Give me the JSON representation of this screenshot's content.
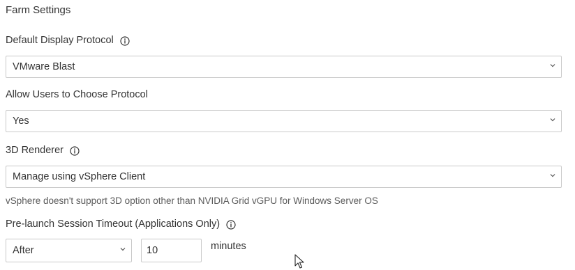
{
  "section": {
    "title": "Farm Settings"
  },
  "display_protocol": {
    "label": "Default Display Protocol",
    "value": "VMware Blast",
    "info_icon": "info-icon"
  },
  "allow_choose_protocol": {
    "label": "Allow Users to Choose Protocol",
    "value": "Yes"
  },
  "renderer_3d": {
    "label": "3D Renderer",
    "value": "Manage using vSphere Client",
    "info_icon": "info-icon",
    "hint": "vSphere doesn't support 3D option other than NVIDIA Grid vGPU for Windows Server OS"
  },
  "prelaunch_timeout": {
    "label": "Pre-launch Session Timeout (Applications Only)",
    "info_icon": "info-icon",
    "mode_value": "After",
    "amount_value": "10",
    "unit": "minutes"
  },
  "colors": {
    "text": "#333333",
    "border": "#c9c9c9",
    "hint_text": "#5a5a5a",
    "background": "#ffffff"
  }
}
